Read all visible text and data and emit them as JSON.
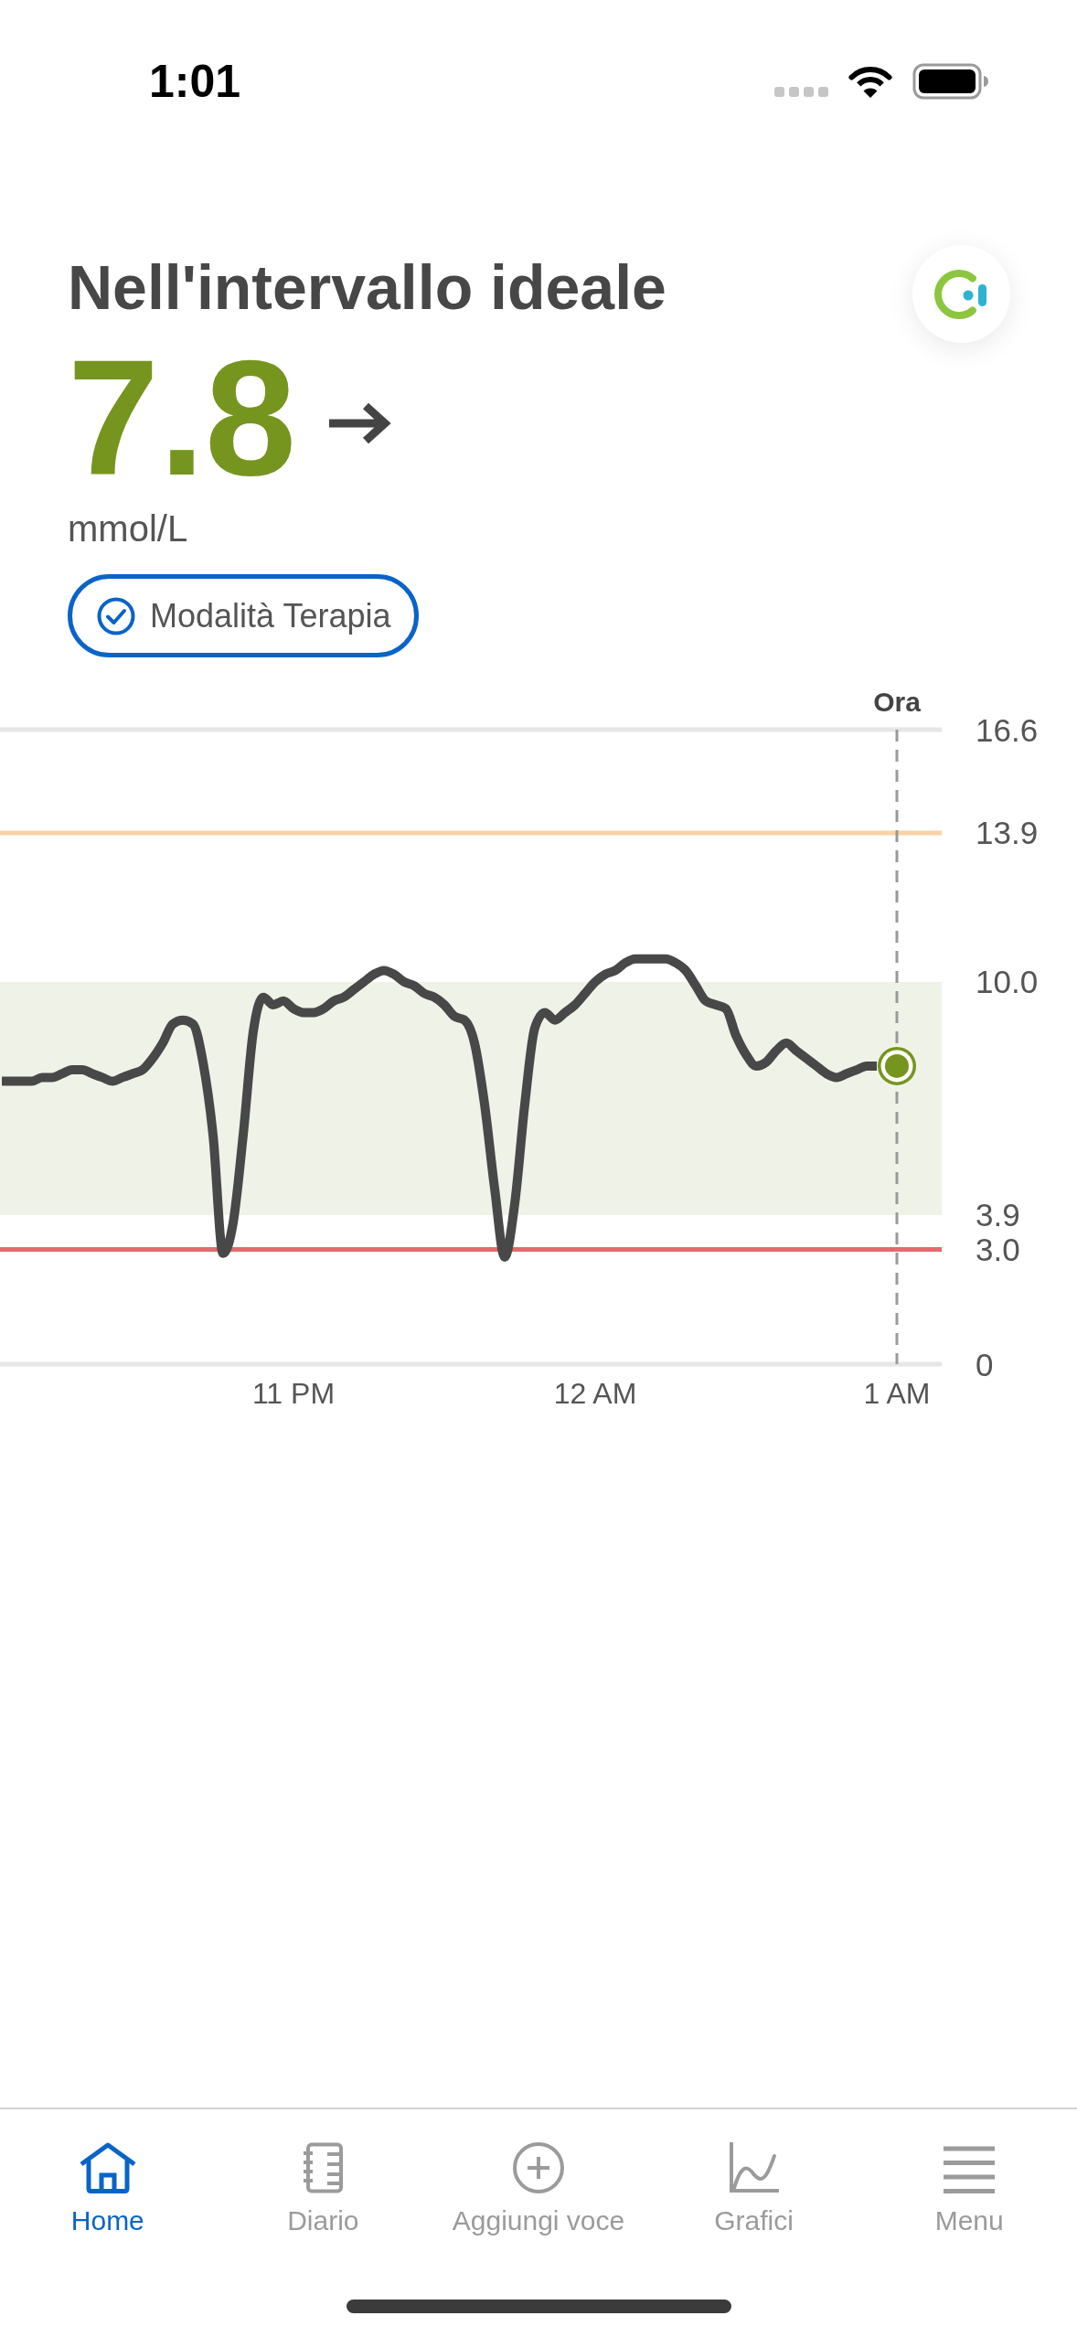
{
  "status_bar": {
    "time": "1:01"
  },
  "header": {
    "title": "Nell'intervallo ideale",
    "reading": "7.8",
    "unit": "mmol/L",
    "badge": "Modalità Terapia"
  },
  "chart": {
    "chart_data": {
      "type": "line",
      "ylim": [
        0,
        16.6
      ],
      "yticks": [
        {
          "value": 16.6,
          "label": "16.6"
        },
        {
          "value": 13.9,
          "label": "13.9"
        },
        {
          "value": 10,
          "label": "10.0"
        },
        {
          "value": 3.9,
          "label": "3.9"
        },
        {
          "value": 3,
          "label": "3.0"
        },
        {
          "value": 0,
          "label": "0"
        }
      ],
      "categories": [
        null,
        null,
        null,
        null,
        null,
        null,
        null,
        null,
        null,
        null,
        null,
        null,
        null,
        null,
        null,
        null,
        null,
        null,
        null,
        null,
        null,
        null,
        null,
        null,
        null,
        null,
        null,
        null,
        null,
        "11 PM",
        null,
        null,
        null,
        null,
        null,
        null,
        null,
        null,
        null,
        null,
        null,
        null,
        null,
        null,
        null,
        null,
        null,
        null,
        null,
        null,
        null,
        null,
        null,
        null,
        null,
        null,
        null,
        null,
        null,
        "12 AM",
        null,
        null,
        null,
        null,
        null,
        null,
        null,
        null,
        null,
        null,
        null,
        null,
        null,
        null,
        null,
        null,
        null,
        null,
        null,
        null,
        null,
        null,
        null,
        null,
        null,
        null,
        null,
        null,
        null,
        "1 AM"
      ],
      "values": [
        7.4,
        7.4,
        7.4,
        7.4,
        7.5,
        7.5,
        7.6,
        7.7,
        7.7,
        7.6,
        7.5,
        7.4,
        7.5,
        7.6,
        7.7,
        8.0,
        8.4,
        8.9,
        9.0,
        8.9,
        7.9,
        6.0,
        2.9,
        3.7,
        6.0,
        8.7,
        9.6,
        9.4,
        9.5,
        9.3,
        9.2,
        9.2,
        9.3,
        9.5,
        9.6,
        9.8,
        10.0,
        10.2,
        10.3,
        10.2,
        10.0,
        9.9,
        9.7,
        9.6,
        9.4,
        9.1,
        9.0,
        8.4,
        6.8,
        4.6,
        2.8,
        4.2,
        6.8,
        8.8,
        9.2,
        9.0,
        9.2,
        9.4,
        9.7,
        10.0,
        10.2,
        10.3,
        10.5,
        10.6,
        10.6,
        10.6,
        10.6,
        10.5,
        10.3,
        9.9,
        9.5,
        9.4,
        9.3,
        8.6,
        8.1,
        7.8,
        7.9,
        8.2,
        8.4,
        8.2,
        8.0,
        7.8,
        7.6,
        7.5,
        7.6,
        7.7,
        7.8,
        7.8,
        null,
        7.8
      ],
      "bands": [
        {
          "axis": "y",
          "from": 3.9,
          "to": 10.0
        }
      ],
      "ref_lines": [
        {
          "axis": "y",
          "value": 13.9,
          "color": "#fdd1a6"
        },
        {
          "axis": "y",
          "value": 3.0,
          "color": "#e26b6b"
        },
        {
          "axis": "x",
          "value": "1 AM",
          "label": "Ora",
          "color": "#9a9a9a"
        }
      ]
    }
  },
  "tab_bar": {
    "tabs": [
      {
        "label": "Home",
        "selected": true
      },
      {
        "label": "Diario",
        "selected": false
      },
      {
        "label": "Aggiungi voce",
        "selected": false
      },
      {
        "label": "Grafici",
        "selected": false
      },
      {
        "label": "Menu",
        "selected": false
      }
    ]
  }
}
